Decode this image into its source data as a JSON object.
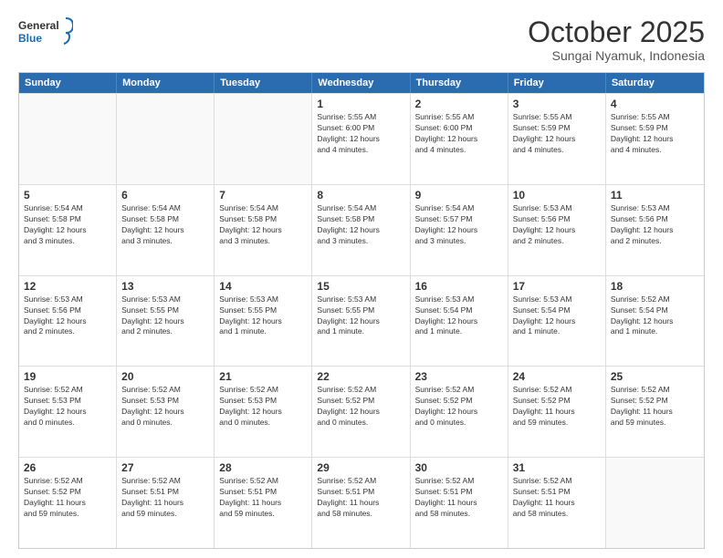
{
  "logo": {
    "line1": "General",
    "line2": "Blue"
  },
  "title": "October 2025",
  "subtitle": "Sungai Nyamuk, Indonesia",
  "header_days": [
    "Sunday",
    "Monday",
    "Tuesday",
    "Wednesday",
    "Thursday",
    "Friday",
    "Saturday"
  ],
  "weeks": [
    [
      {
        "day": "",
        "info": "",
        "empty": true
      },
      {
        "day": "",
        "info": "",
        "empty": true
      },
      {
        "day": "",
        "info": "",
        "empty": true
      },
      {
        "day": "1",
        "info": "Sunrise: 5:55 AM\nSunset: 6:00 PM\nDaylight: 12 hours\nand 4 minutes.",
        "empty": false
      },
      {
        "day": "2",
        "info": "Sunrise: 5:55 AM\nSunset: 6:00 PM\nDaylight: 12 hours\nand 4 minutes.",
        "empty": false
      },
      {
        "day": "3",
        "info": "Sunrise: 5:55 AM\nSunset: 5:59 PM\nDaylight: 12 hours\nand 4 minutes.",
        "empty": false
      },
      {
        "day": "4",
        "info": "Sunrise: 5:55 AM\nSunset: 5:59 PM\nDaylight: 12 hours\nand 4 minutes.",
        "empty": false
      }
    ],
    [
      {
        "day": "5",
        "info": "Sunrise: 5:54 AM\nSunset: 5:58 PM\nDaylight: 12 hours\nand 3 minutes.",
        "empty": false
      },
      {
        "day": "6",
        "info": "Sunrise: 5:54 AM\nSunset: 5:58 PM\nDaylight: 12 hours\nand 3 minutes.",
        "empty": false
      },
      {
        "day": "7",
        "info": "Sunrise: 5:54 AM\nSunset: 5:58 PM\nDaylight: 12 hours\nand 3 minutes.",
        "empty": false
      },
      {
        "day": "8",
        "info": "Sunrise: 5:54 AM\nSunset: 5:58 PM\nDaylight: 12 hours\nand 3 minutes.",
        "empty": false
      },
      {
        "day": "9",
        "info": "Sunrise: 5:54 AM\nSunset: 5:57 PM\nDaylight: 12 hours\nand 3 minutes.",
        "empty": false
      },
      {
        "day": "10",
        "info": "Sunrise: 5:53 AM\nSunset: 5:56 PM\nDaylight: 12 hours\nand 2 minutes.",
        "empty": false
      },
      {
        "day": "11",
        "info": "Sunrise: 5:53 AM\nSunset: 5:56 PM\nDaylight: 12 hours\nand 2 minutes.",
        "empty": false
      }
    ],
    [
      {
        "day": "12",
        "info": "Sunrise: 5:53 AM\nSunset: 5:56 PM\nDaylight: 12 hours\nand 2 minutes.",
        "empty": false
      },
      {
        "day": "13",
        "info": "Sunrise: 5:53 AM\nSunset: 5:55 PM\nDaylight: 12 hours\nand 2 minutes.",
        "empty": false
      },
      {
        "day": "14",
        "info": "Sunrise: 5:53 AM\nSunset: 5:55 PM\nDaylight: 12 hours\nand 1 minute.",
        "empty": false
      },
      {
        "day": "15",
        "info": "Sunrise: 5:53 AM\nSunset: 5:55 PM\nDaylight: 12 hours\nand 1 minute.",
        "empty": false
      },
      {
        "day": "16",
        "info": "Sunrise: 5:53 AM\nSunset: 5:54 PM\nDaylight: 12 hours\nand 1 minute.",
        "empty": false
      },
      {
        "day": "17",
        "info": "Sunrise: 5:53 AM\nSunset: 5:54 PM\nDaylight: 12 hours\nand 1 minute.",
        "empty": false
      },
      {
        "day": "18",
        "info": "Sunrise: 5:52 AM\nSunset: 5:54 PM\nDaylight: 12 hours\nand 1 minute.",
        "empty": false
      }
    ],
    [
      {
        "day": "19",
        "info": "Sunrise: 5:52 AM\nSunset: 5:53 PM\nDaylight: 12 hours\nand 0 minutes.",
        "empty": false
      },
      {
        "day": "20",
        "info": "Sunrise: 5:52 AM\nSunset: 5:53 PM\nDaylight: 12 hours\nand 0 minutes.",
        "empty": false
      },
      {
        "day": "21",
        "info": "Sunrise: 5:52 AM\nSunset: 5:53 PM\nDaylight: 12 hours\nand 0 minutes.",
        "empty": false
      },
      {
        "day": "22",
        "info": "Sunrise: 5:52 AM\nSunset: 5:52 PM\nDaylight: 12 hours\nand 0 minutes.",
        "empty": false
      },
      {
        "day": "23",
        "info": "Sunrise: 5:52 AM\nSunset: 5:52 PM\nDaylight: 12 hours\nand 0 minutes.",
        "empty": false
      },
      {
        "day": "24",
        "info": "Sunrise: 5:52 AM\nSunset: 5:52 PM\nDaylight: 11 hours\nand 59 minutes.",
        "empty": false
      },
      {
        "day": "25",
        "info": "Sunrise: 5:52 AM\nSunset: 5:52 PM\nDaylight: 11 hours\nand 59 minutes.",
        "empty": false
      }
    ],
    [
      {
        "day": "26",
        "info": "Sunrise: 5:52 AM\nSunset: 5:52 PM\nDaylight: 11 hours\nand 59 minutes.",
        "empty": false
      },
      {
        "day": "27",
        "info": "Sunrise: 5:52 AM\nSunset: 5:51 PM\nDaylight: 11 hours\nand 59 minutes.",
        "empty": false
      },
      {
        "day": "28",
        "info": "Sunrise: 5:52 AM\nSunset: 5:51 PM\nDaylight: 11 hours\nand 59 minutes.",
        "empty": false
      },
      {
        "day": "29",
        "info": "Sunrise: 5:52 AM\nSunset: 5:51 PM\nDaylight: 11 hours\nand 58 minutes.",
        "empty": false
      },
      {
        "day": "30",
        "info": "Sunrise: 5:52 AM\nSunset: 5:51 PM\nDaylight: 11 hours\nand 58 minutes.",
        "empty": false
      },
      {
        "day": "31",
        "info": "Sunrise: 5:52 AM\nSunset: 5:51 PM\nDaylight: 11 hours\nand 58 minutes.",
        "empty": false
      },
      {
        "day": "",
        "info": "",
        "empty": true
      }
    ]
  ]
}
